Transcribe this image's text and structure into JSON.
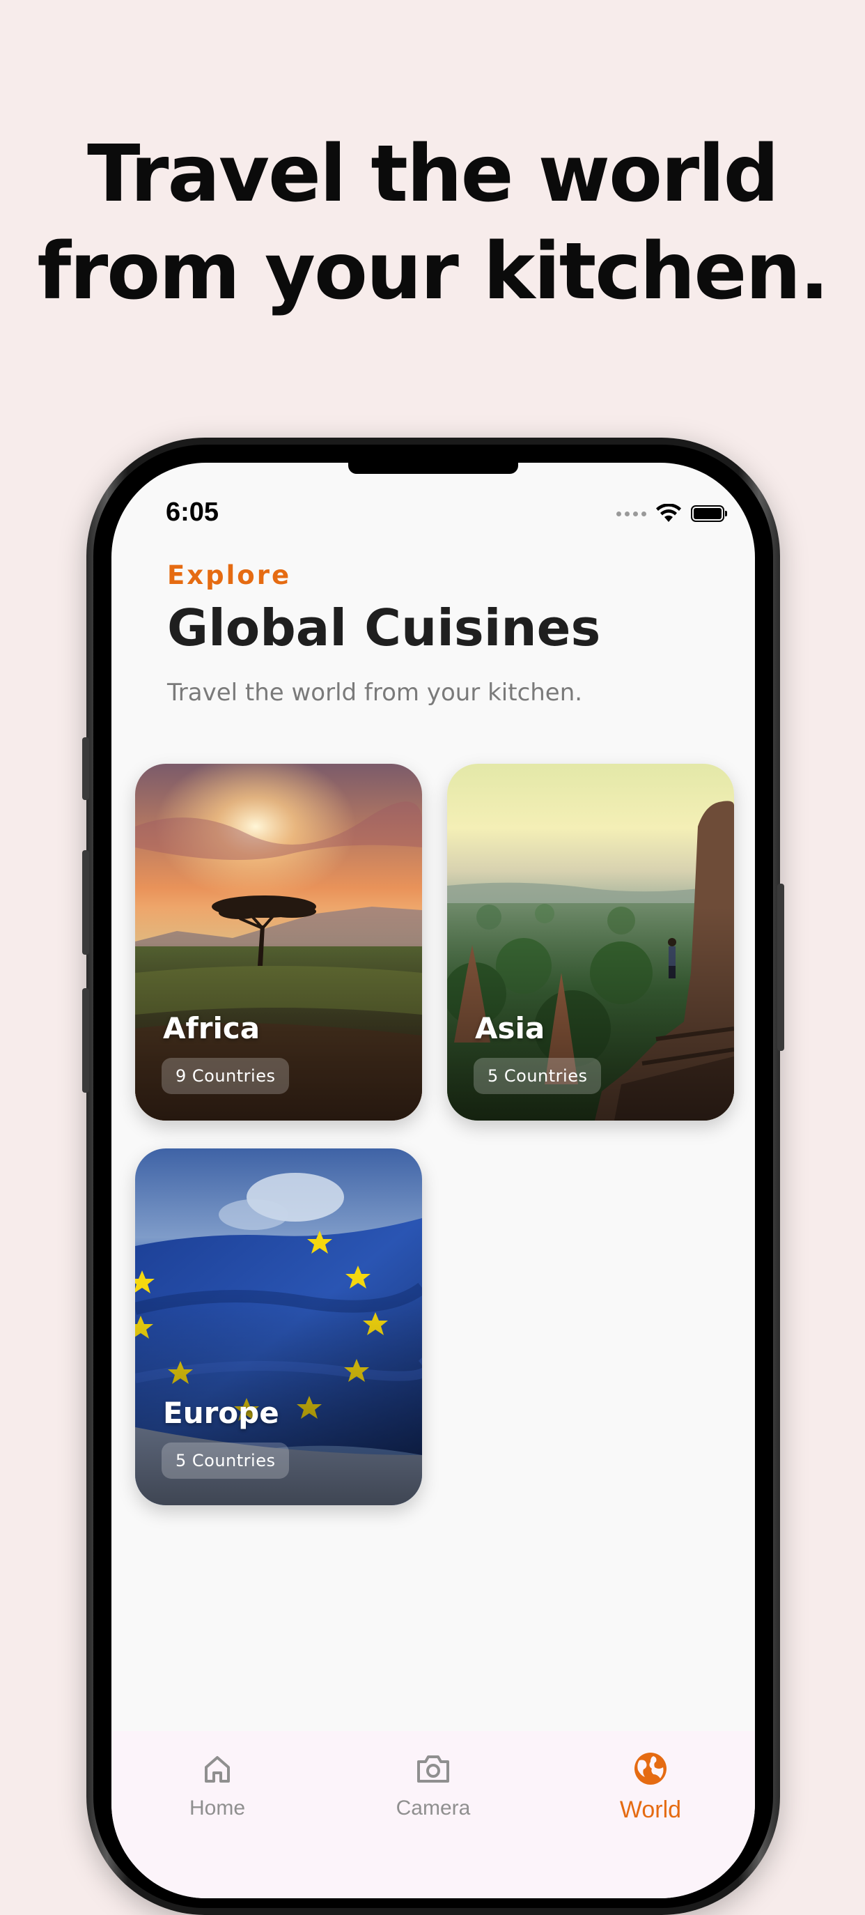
{
  "promo": {
    "headline_line1": "Travel the world",
    "headline_line2": "from your kitchen."
  },
  "status_bar": {
    "time": "6:05"
  },
  "header": {
    "eyebrow": "Explore",
    "title": "Global Cuisines",
    "subtitle": "Travel the world from your kitchen."
  },
  "regions": [
    {
      "name": "Africa",
      "count_label": "9 Countries",
      "image": "savanna-sunset-acacia-tree"
    },
    {
      "name": "Asia",
      "count_label": "5 Countries",
      "image": "temples-jungle-landscape"
    },
    {
      "name": "Europe",
      "count_label": "5 Countries",
      "image": "eu-flag-waving"
    }
  ],
  "bottom_nav": {
    "items": [
      {
        "label": "Home",
        "icon": "home-icon",
        "active": false
      },
      {
        "label": "Camera",
        "icon": "camera-icon",
        "active": false
      },
      {
        "label": "World",
        "icon": "globe-icon",
        "active": true
      }
    ]
  },
  "colors": {
    "background": "#f7eceb",
    "accent": "#e56b12",
    "title": "#1f1f1f",
    "subtitle": "#7a7a7a",
    "nav_inactive": "#8f8f8f",
    "nav_background": "#fcf4fa"
  }
}
